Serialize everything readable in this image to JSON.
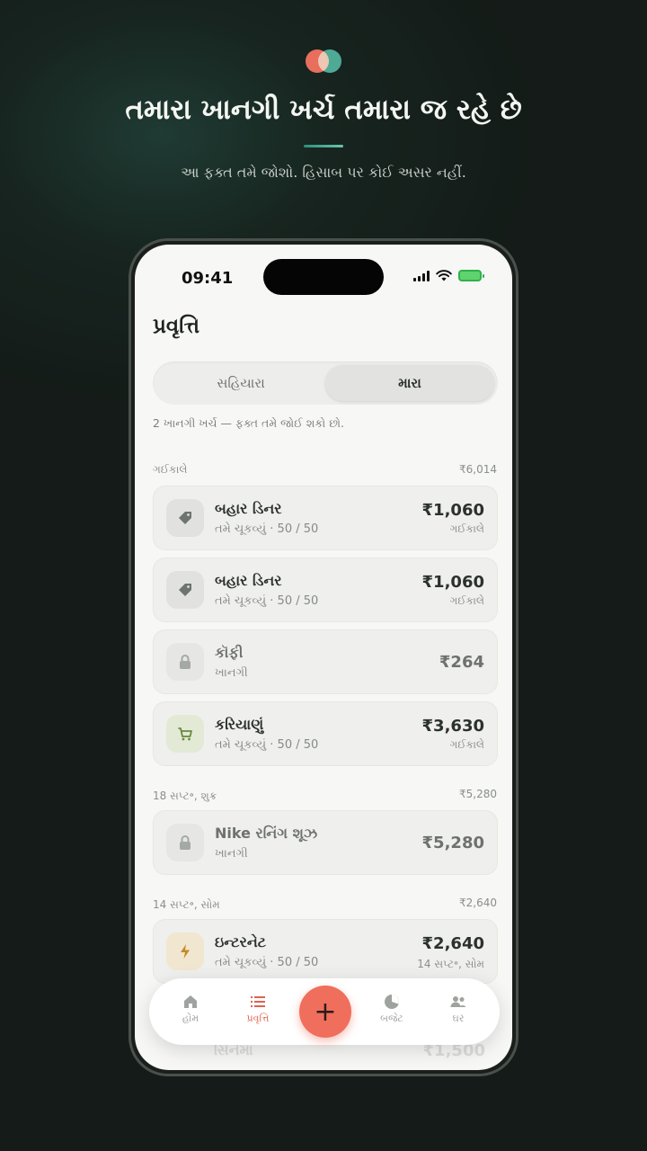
{
  "header": {
    "headline": "તમારા ખાનગી ખર્ચ તમારા જ રહે છે",
    "subline": "આ ફક્ત તમે જોશો. હિસાબ પર કોઈ અસર નહીં."
  },
  "status": {
    "time": "09:41"
  },
  "screen": {
    "title": "પ્રવૃત્તિ",
    "segments": [
      "સહિયારા",
      "મારા"
    ],
    "selected_segment": "મારા",
    "note": "2 ખાનગી ખર્ચ — ફક્ત તમે જોઈ શકો છો."
  },
  "groups": [
    {
      "label": "ગઈકાલે",
      "total": "₹6,014",
      "items": [
        {
          "title": "બહાર ડિનર",
          "subtitle": "તમે ચૂકવ્યું · 50 / 50",
          "amount": "₹1,060",
          "date": "ગઈકાલે",
          "icon": "tag-icon"
        },
        {
          "title": "બહાર ડિનર",
          "subtitle": "તમે ચૂકવ્યું · 50 / 50",
          "amount": "₹1,060",
          "date": "ગઈકાલે",
          "icon": "tag-icon"
        },
        {
          "title": "કૉફી",
          "subtitle": "ખાનગી",
          "amount": "₹264",
          "date": "",
          "icon": "lock-icon"
        },
        {
          "title": "કરિયાણું",
          "subtitle": "તમે ચૂકવ્યું · 50 / 50",
          "amount": "₹3,630",
          "date": "ગઈકાલે",
          "icon": "cart-icon"
        }
      ]
    },
    {
      "label": "18 સપ્ટ॰, શુક્ર",
      "total": "₹5,280",
      "items": [
        {
          "title": "Nike રનિંગ શૂઝ",
          "subtitle": "ખાનગી",
          "amount": "₹5,280",
          "date": "",
          "icon": "lock-icon"
        }
      ]
    },
    {
      "label": "14 સપ્ટ॰, સોમ",
      "total": "₹2,640",
      "items": [
        {
          "title": "ઇન્ટરનેટ",
          "subtitle": "તમે ચૂકવ્યું · 50 / 50",
          "amount": "₹2,640",
          "date": "14 સપ્ટ॰, સોમ",
          "icon": "bolt-icon"
        }
      ]
    }
  ],
  "partial_item": {
    "title": "સિનેમા",
    "amount": "₹1,500"
  },
  "tabbar": {
    "home": "હોમ",
    "activity": "પ્રવૃત્તિ",
    "add": "+",
    "budget": "બજેટ",
    "household": "ઘર",
    "active": "activity"
  },
  "colors": {
    "accent": "#ef6f5c",
    "brand_green": "#3fa58e",
    "background": "#141b18"
  }
}
